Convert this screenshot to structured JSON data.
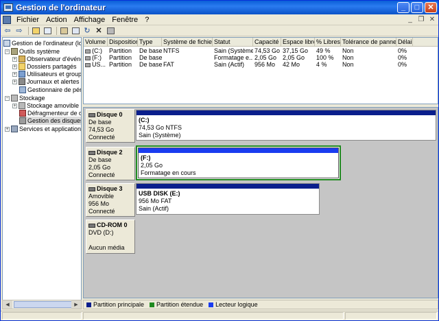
{
  "window": {
    "title": "Gestion de l'ordinateur"
  },
  "menu": {
    "items": [
      "Fichier",
      "Action",
      "Affichage",
      "Fenêtre",
      "?"
    ]
  },
  "tree": {
    "items": [
      {
        "label": "Gestion de l'ordinateur (local",
        "icon": "computer-icon"
      },
      {
        "label": "Outils système",
        "icon": "tools-icon"
      },
      {
        "label": "Observateur d'événem",
        "icon": "event-viewer-icon"
      },
      {
        "label": "Dossiers partagés",
        "icon": "shared-folder-icon"
      },
      {
        "label": "Utilisateurs et groupes",
        "icon": "users-icon"
      },
      {
        "label": "Journaux et alertes de",
        "icon": "performance-log-icon"
      },
      {
        "label": "Gestionnaire de périph",
        "icon": "device-manager-icon"
      },
      {
        "label": "Stockage",
        "icon": "storage-icon"
      },
      {
        "label": "Stockage amovible",
        "icon": "removable-storage-icon"
      },
      {
        "label": "Défragmenteur de disq",
        "icon": "defrag-icon"
      },
      {
        "label": "Gestion des disques",
        "icon": "disk-management-icon"
      },
      {
        "label": "Services et applications",
        "icon": "services-icon"
      }
    ]
  },
  "volumes": {
    "columns": [
      "Volume",
      "Disposition",
      "Type",
      "Système de fichiers",
      "Statut",
      "Capacité",
      "Espace libre",
      "% Libres",
      "Tolérance de pannes",
      "Délai"
    ],
    "rows": [
      [
        "(C:)",
        "Partition",
        "De base",
        "NTFS",
        "Sain (Système)",
        "74,53 Go",
        "37,15 Go",
        "49 %",
        "Non",
        "0%"
      ],
      [
        "(F:)",
        "Partition",
        "De base",
        "",
        "Formatage e...",
        "2,05 Go",
        "2,05 Go",
        "100 %",
        "Non",
        "0%"
      ],
      [
        "US...",
        "Partition",
        "De base",
        "FAT",
        "Sain (Actif)",
        "956 Mo",
        "42 Mo",
        "4 %",
        "Non",
        "0%"
      ]
    ]
  },
  "disks": [
    {
      "name": "Disque 0",
      "type": "De base",
      "size": "74,53 Go",
      "status": "Connecté",
      "partition": {
        "name": "(C:)",
        "line1": "74,53 Go NTFS",
        "line2": "Sain (Système)"
      }
    },
    {
      "name": "Disque 2",
      "type": "De base",
      "size": "2,05 Go",
      "status": "Connecté",
      "partition": {
        "name": "(F:)",
        "line1": "2,05 Go",
        "line2": "Formatage en cours"
      }
    },
    {
      "name": "Disque 3",
      "type": "Amovible",
      "size": "956 Mo",
      "status": "Connecté",
      "partition": {
        "name": "USB DISK  (E:)",
        "line1": "956 Mo FAT",
        "line2": "Sain (Actif)"
      }
    },
    {
      "name": "CD-ROM 0",
      "type": "DVD (D:)",
      "size": "",
      "status": "Aucun média"
    }
  ],
  "legend": [
    {
      "label": "Partition principale",
      "color": "#0a1e8c"
    },
    {
      "label": "Partition étendue",
      "color": "#1f8a1f"
    },
    {
      "label": "Lecteur logique",
      "color": "#1a3cf0"
    }
  ]
}
